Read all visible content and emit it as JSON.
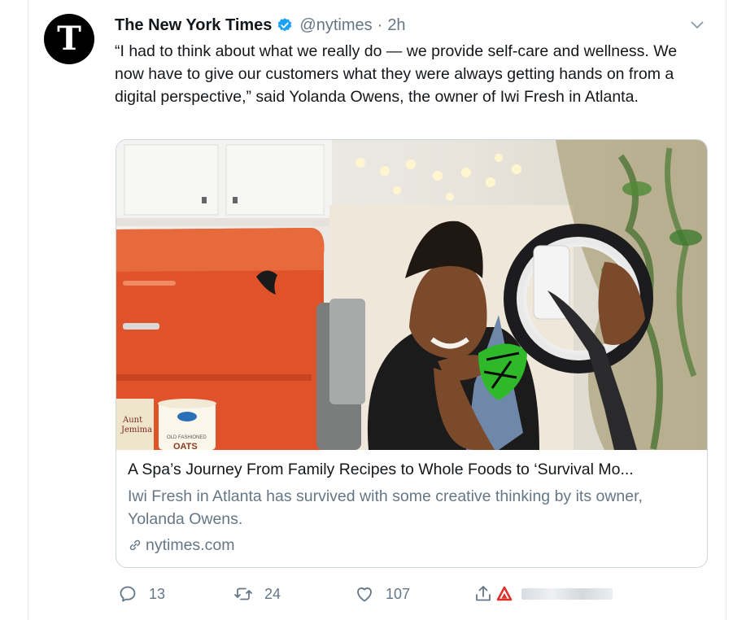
{
  "tweet": {
    "avatar_letter": "T",
    "author_name": "The New York Times",
    "verified_color": "#1da1f2",
    "handle": "@nytimes",
    "separator": "·",
    "time": "2h",
    "body": "“I had to think about what we really do — we provide self-care and wellness. We now have to give our customers what they were always getting hands on from a digital perspective,” said Yolanda Owens, the owner of Iwi Fresh in Atlanta."
  },
  "card": {
    "title": "A Spa’s Journey From Family Recipes to Whole Foods to ‘Survival Mo...",
    "description": "Iwi Fresh in Atlanta has survived with some creative thinking by its owner, Yolanda Owens.",
    "domain": "nytimes.com",
    "image_text": {
      "container_brand_line1": "Aunt",
      "container_brand_line2": "Jemima",
      "oats_label_line1": "OLD FASHIONED",
      "oats_label_line2": "OATS"
    }
  },
  "actions": {
    "reply_count": "13",
    "retweet_count": "24",
    "like_count": "107"
  },
  "colors": {
    "text_primary": "#14171a",
    "text_secondary": "#657786",
    "border": "#ccd6dd",
    "brave_icon": "#e0302b"
  },
  "icons": [
    "caret-down-icon",
    "verified-badge-icon",
    "reply-icon",
    "retweet-icon",
    "like-icon",
    "share-icon",
    "brave-icon",
    "link-icon"
  ]
}
